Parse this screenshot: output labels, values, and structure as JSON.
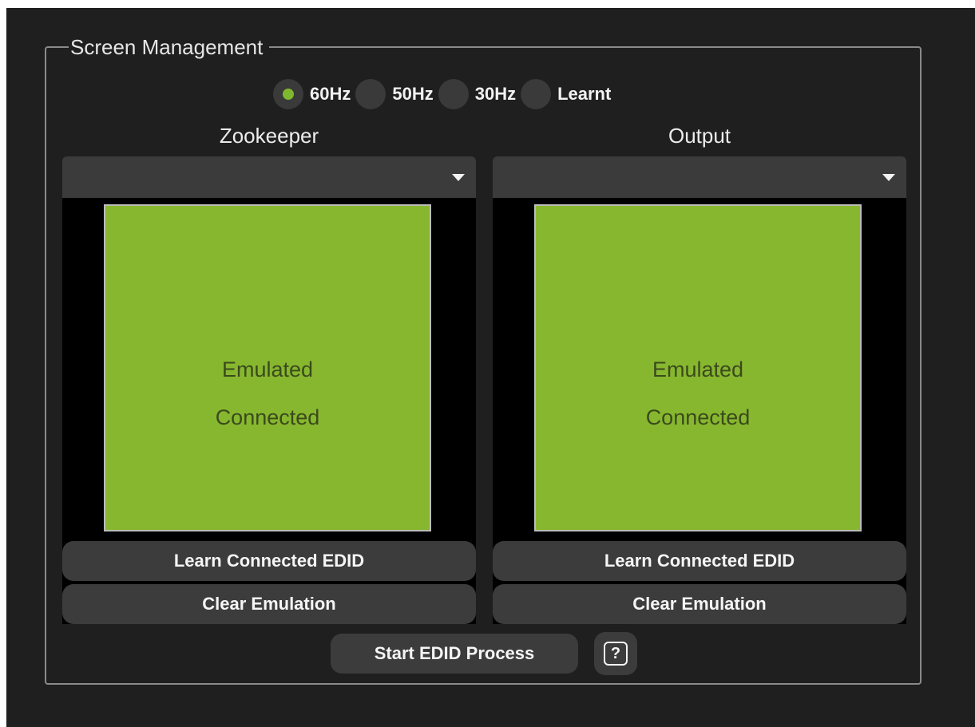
{
  "group": {
    "title": "Screen Management"
  },
  "refresh_rates": [
    {
      "label": "60Hz",
      "selected": true
    },
    {
      "label": "50Hz",
      "selected": false
    },
    {
      "label": "30Hz",
      "selected": false
    },
    {
      "label": "Learnt",
      "selected": false
    }
  ],
  "columns": [
    {
      "title": "Zookeeper",
      "dropdown_value": "",
      "screen_status": [
        "Emulated",
        "Connected"
      ],
      "learn_button": "Learn Connected EDID",
      "clear_button": "Clear Emulation"
    },
    {
      "title": "Output",
      "dropdown_value": "",
      "screen_status": [
        "Emulated",
        "Connected"
      ],
      "learn_button": "Learn Connected EDID",
      "clear_button": "Clear Emulation"
    }
  ],
  "start_button": "Start EDID Process",
  "help_button": "?",
  "colors": {
    "background": "#1f1f1f",
    "screen_green": "#87b72f",
    "radio_selected": "#7fb82e",
    "button": "#3c3c3c"
  }
}
